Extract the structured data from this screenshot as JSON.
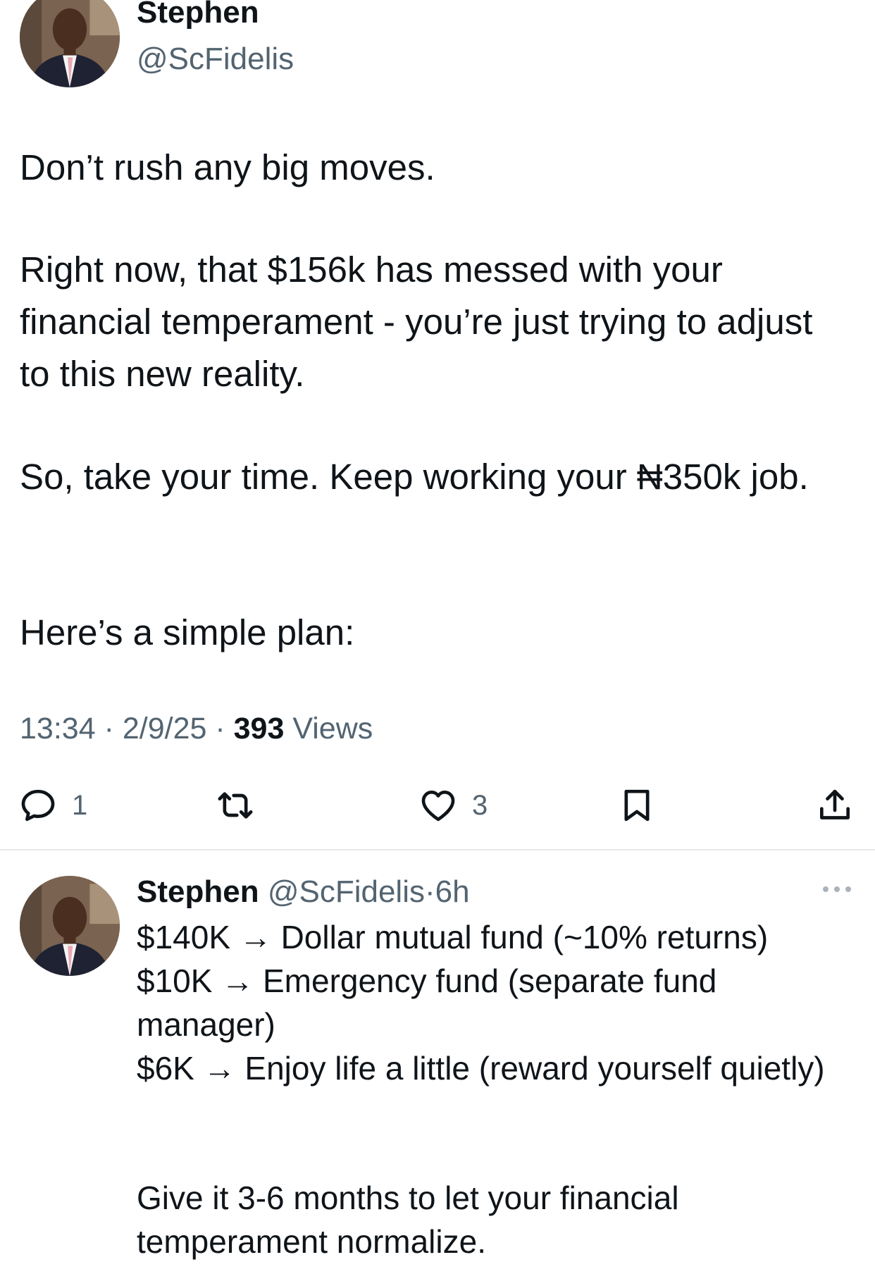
{
  "tweet": {
    "author_name": "Stephen",
    "author_handle": "@ScFidelis",
    "paragraphs": [
      "Don’t rush any big moves.",
      "Right now, that $156k has messed with your financial temperament - you’re just trying to adjust to this new reality.",
      "So, take your time. Keep working your ₦350k job.",
      "Here’s a simple plan:"
    ],
    "time": "13:34",
    "date": "2/9/25",
    "separator": "·",
    "views_count": "393",
    "views_label": "Views",
    "actions": {
      "reply_count": "1",
      "retweet_count": "",
      "like_count": "3"
    }
  },
  "reply": {
    "author_name": "Stephen",
    "author_handle": "@ScFidelis",
    "separator": "·",
    "time_ago": "6h",
    "lines": [
      "$140K → Dollar mutual fund (~10% returns)",
      "$10K → Emergency fund (separate fund manager)",
      "$6K → Enjoy life a little (reward yourself quietly)",
      "Give it 3-6 months to let your financial temperament normalize."
    ]
  },
  "icons": {
    "reply": "comment-bubble-icon",
    "retweet": "retweet-icon",
    "like": "heart-icon",
    "bookmark": "bookmark-icon",
    "share": "share-icon",
    "more": "more-dots-icon"
  },
  "colors": {
    "text_primary": "#0f1419",
    "text_secondary": "#536471",
    "divider": "#e6e9ec"
  }
}
